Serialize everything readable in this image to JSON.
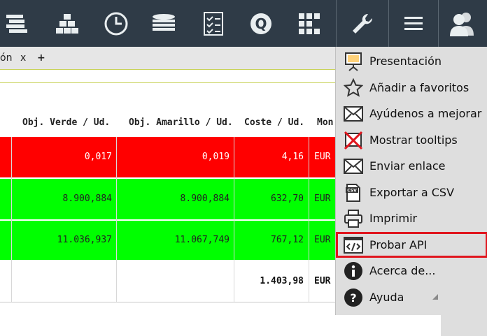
{
  "toolbar": {
    "icons": [
      "list-bars-icon",
      "stack-boxes-icon",
      "clock-icon",
      "coins-icon",
      "checklist-icon",
      "q-logo-icon",
      "grid-icon",
      "wrench-icon",
      "hamburger-icon",
      "user-icon"
    ]
  },
  "tabbar": {
    "partial_label": "ón",
    "close": "x",
    "add": "+"
  },
  "table": {
    "headers": [
      "Obj. Verde / Ud.",
      "Obj. Amarillo / Ud.",
      "Coste / Ud.",
      "Mon"
    ],
    "rows": [
      {
        "color": "#ff0000",
        "verde": "0,017",
        "amarillo": "0,019",
        "coste": "4,16",
        "mon": "EUR"
      },
      {
        "color": "#00ff00",
        "verde": "8.900,884",
        "amarillo": "8.900,884",
        "coste": "632,70",
        "mon": "EUR"
      },
      {
        "color": "#00ff00",
        "verde": "11.036,937",
        "amarillo": "11.067,749",
        "coste": "767,12",
        "mon": "EUR"
      }
    ],
    "total": {
      "coste": "1.403,98",
      "mon": "EUR"
    }
  },
  "menu": {
    "items": [
      {
        "label": "Presentación",
        "icon": "presentation-icon"
      },
      {
        "label": "Añadir a favoritos",
        "icon": "star-icon"
      },
      {
        "label": "Ayúdenos a mejorar",
        "icon": "envelope-icon"
      },
      {
        "label": "Mostrar tooltips",
        "icon": "tooltip-off-icon"
      },
      {
        "label": "Enviar enlace",
        "icon": "envelope-icon"
      },
      {
        "label": "Exportar a CSV",
        "icon": "csv-icon"
      },
      {
        "label": "Imprimir",
        "icon": "printer-icon"
      },
      {
        "label": "Probar API",
        "icon": "code-icon"
      },
      {
        "label": "Acerca de...",
        "icon": "info-icon"
      },
      {
        "label": "Ayuda",
        "icon": "help-icon"
      }
    ],
    "highlighted_index": 7
  }
}
